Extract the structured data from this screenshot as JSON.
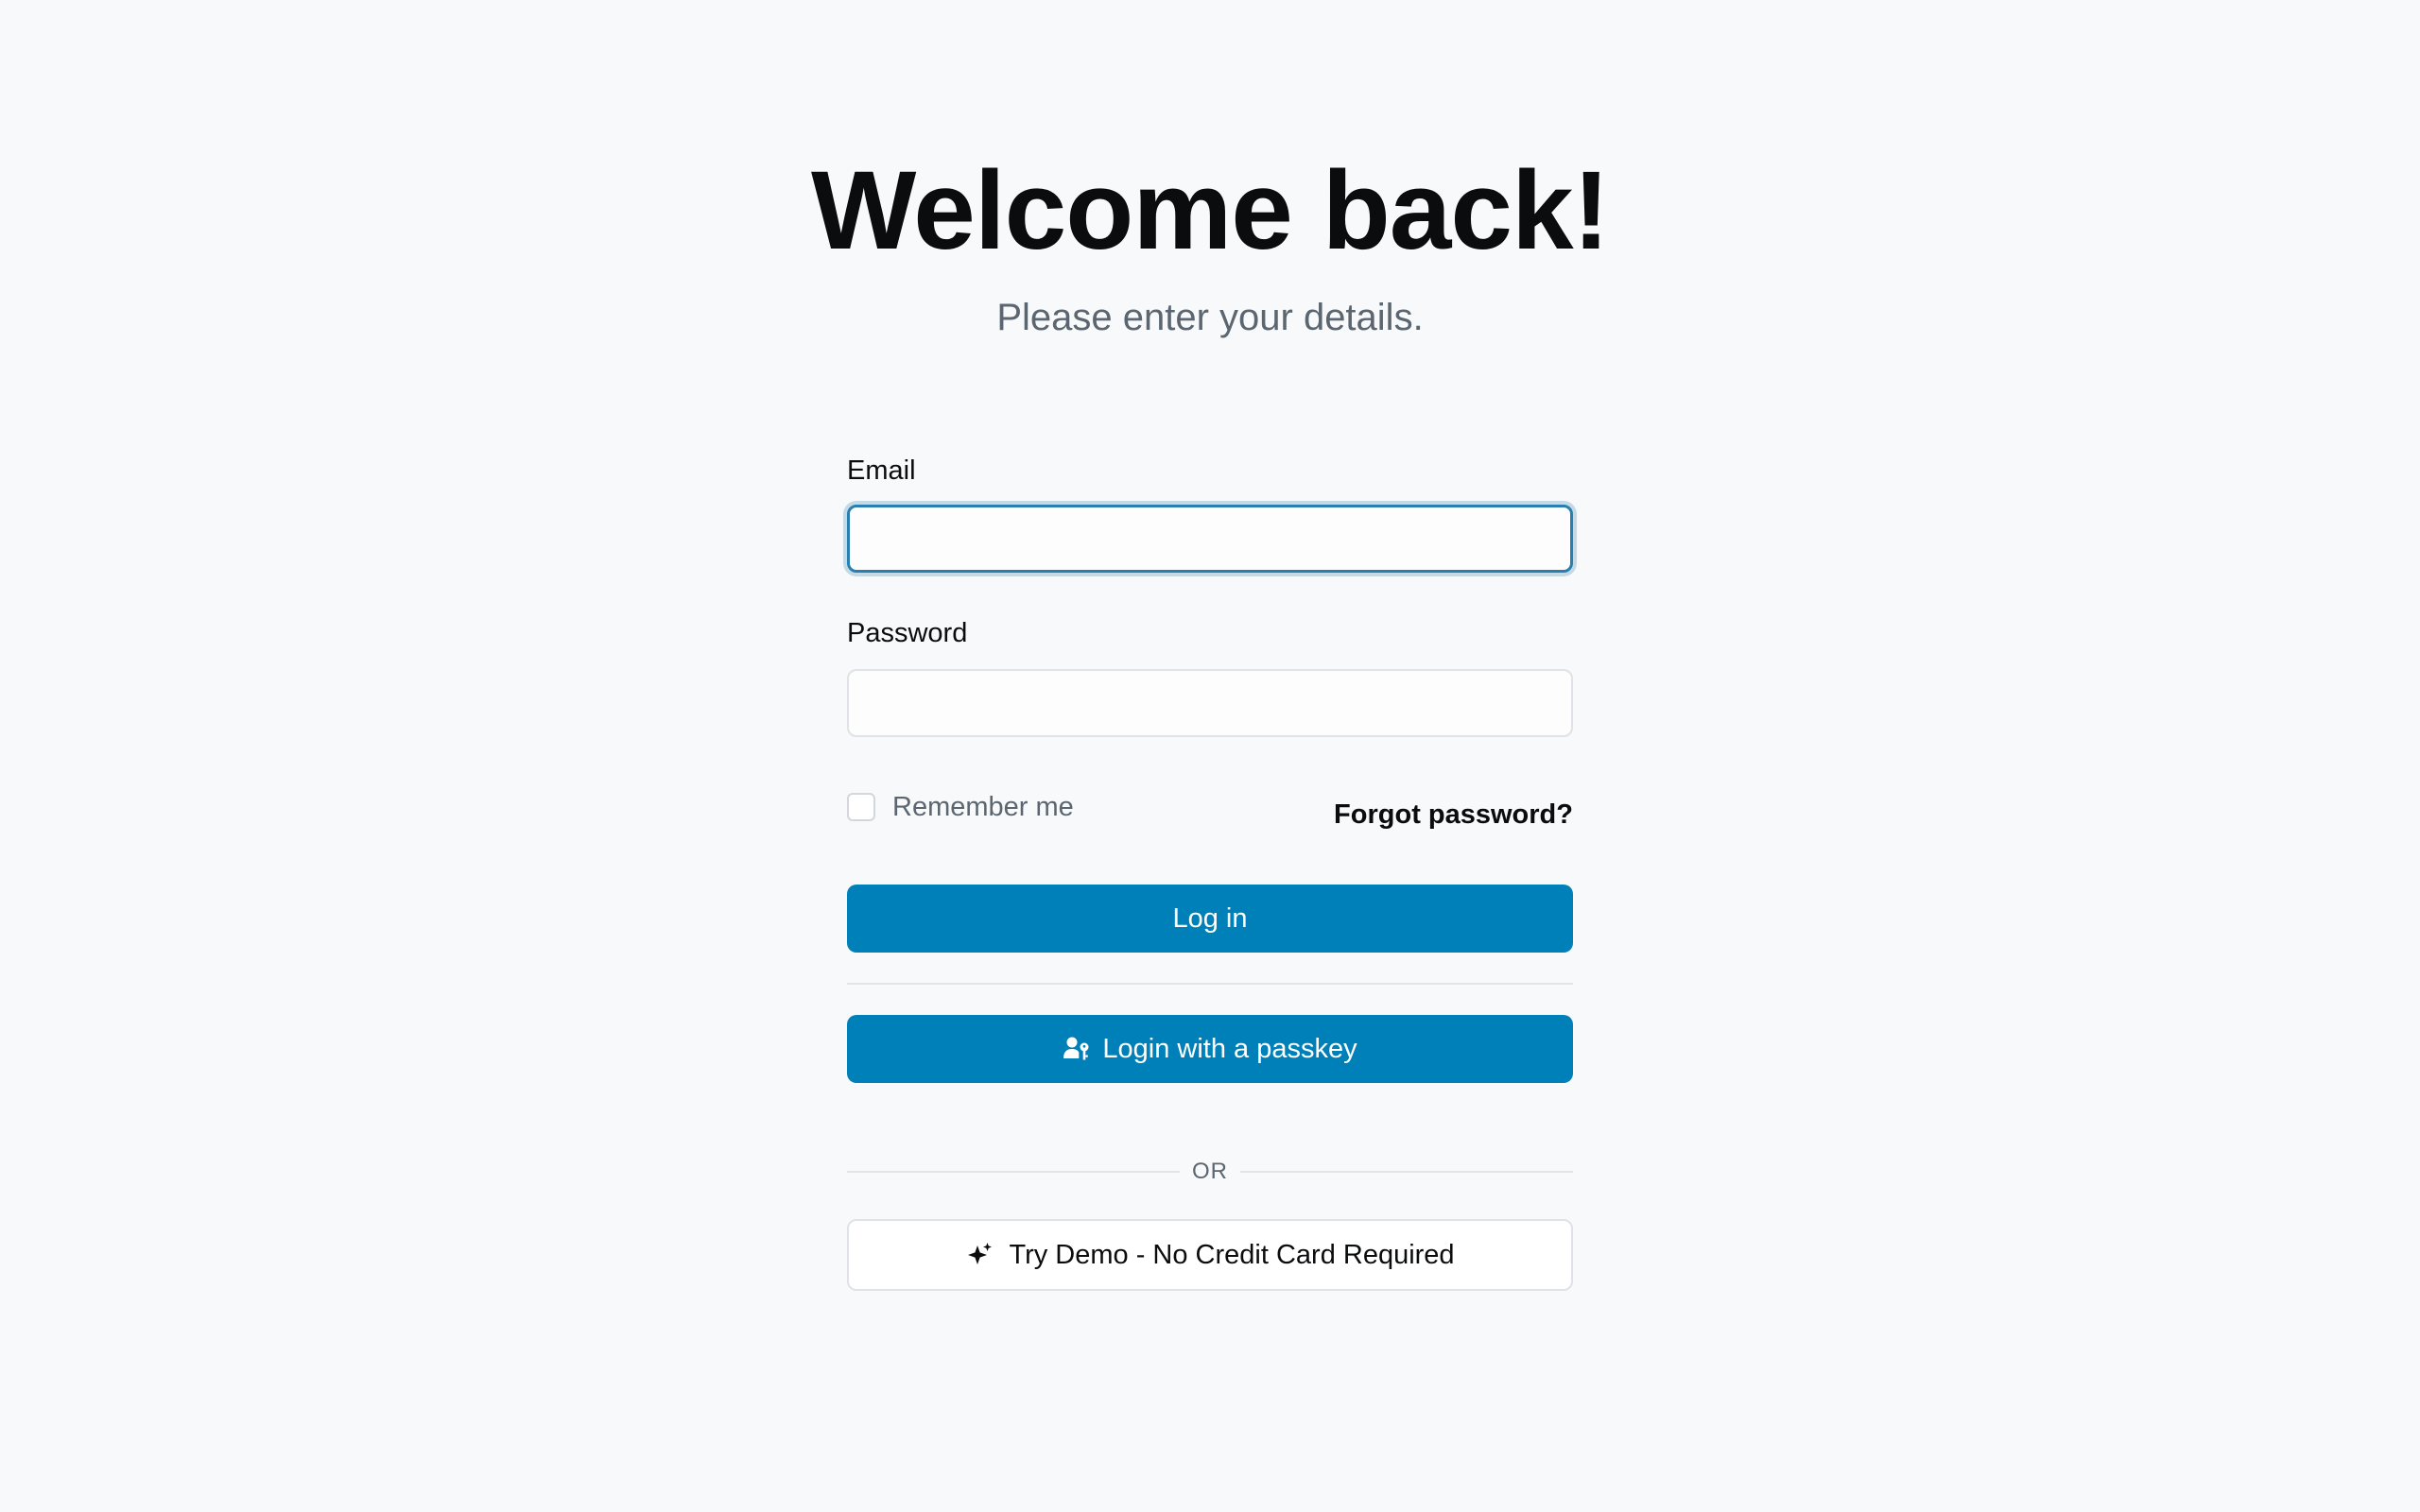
{
  "header": {
    "title": "Welcome back!",
    "subtitle": "Please enter your details."
  },
  "form": {
    "email": {
      "label": "Email",
      "value": "",
      "placeholder": ""
    },
    "password": {
      "label": "Password",
      "value": "",
      "placeholder": ""
    },
    "remember_me": {
      "label": "Remember me",
      "checked": false
    },
    "forgot_password_label": "Forgot password?",
    "login_button_label": "Log in",
    "passkey_button_label": "Login with a passkey",
    "or_label": "OR",
    "demo_button_label": "Try Demo - No Credit Card Required"
  },
  "icons": {
    "passkey": "user-key-icon",
    "demo": "sparkle-icon"
  },
  "colors": {
    "primary": "#0080b8",
    "focus_ring": "#2a7fb0",
    "background": "#f8f9fa",
    "muted_text": "#5b6670"
  }
}
